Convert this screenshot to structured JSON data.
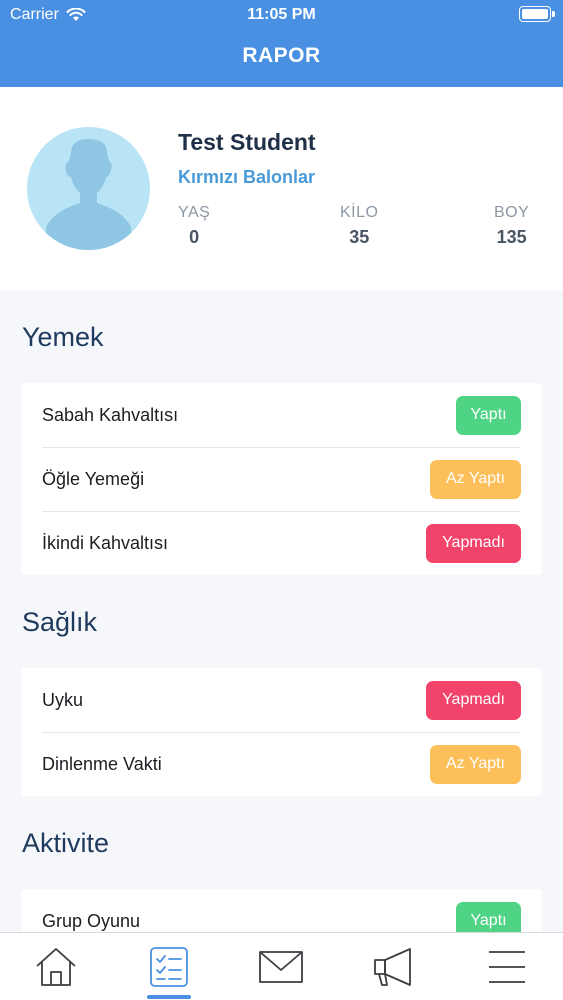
{
  "status_bar": {
    "carrier": "Carrier",
    "time": "11:05 PM"
  },
  "nav": {
    "title": "RAPOR"
  },
  "profile": {
    "name": "Test Student",
    "class_name": "Kırmızı Balonlar",
    "stats": [
      {
        "label": "YAŞ",
        "value": "0"
      },
      {
        "label": "KİLO",
        "value": "35"
      },
      {
        "label": "BOY",
        "value": "135"
      }
    ]
  },
  "sections": [
    {
      "title": "Yemek",
      "items": [
        {
          "label": "Sabah Kahvaltısı",
          "status": "Yaptı",
          "color": "#4fd485"
        },
        {
          "label": "Öğle Yemeği",
          "status": "Az Yaptı",
          "color": "#fdbf5a"
        },
        {
          "label": "İkindi Kahvaltısı",
          "status": "Yapmadı",
          "color": "#f2436a"
        }
      ]
    },
    {
      "title": "Sağlık",
      "items": [
        {
          "label": "Uyku",
          "status": "Yapmadı",
          "color": "#f2436a"
        },
        {
          "label": "Dinlenme Vakti",
          "status": "Az Yaptı",
          "color": "#fdbf5a"
        }
      ]
    },
    {
      "title": "Aktivite",
      "items": [
        {
          "label": "Grup Oyunu",
          "status": "Yaptı",
          "color": "#4fd485"
        }
      ]
    }
  ],
  "tabbar": {
    "items": [
      {
        "icon": "home-icon"
      },
      {
        "icon": "checklist-icon",
        "active": true
      },
      {
        "icon": "mail-icon"
      },
      {
        "icon": "megaphone-icon"
      },
      {
        "icon": "menu-icon"
      }
    ],
    "accent": "#4a90e2"
  }
}
